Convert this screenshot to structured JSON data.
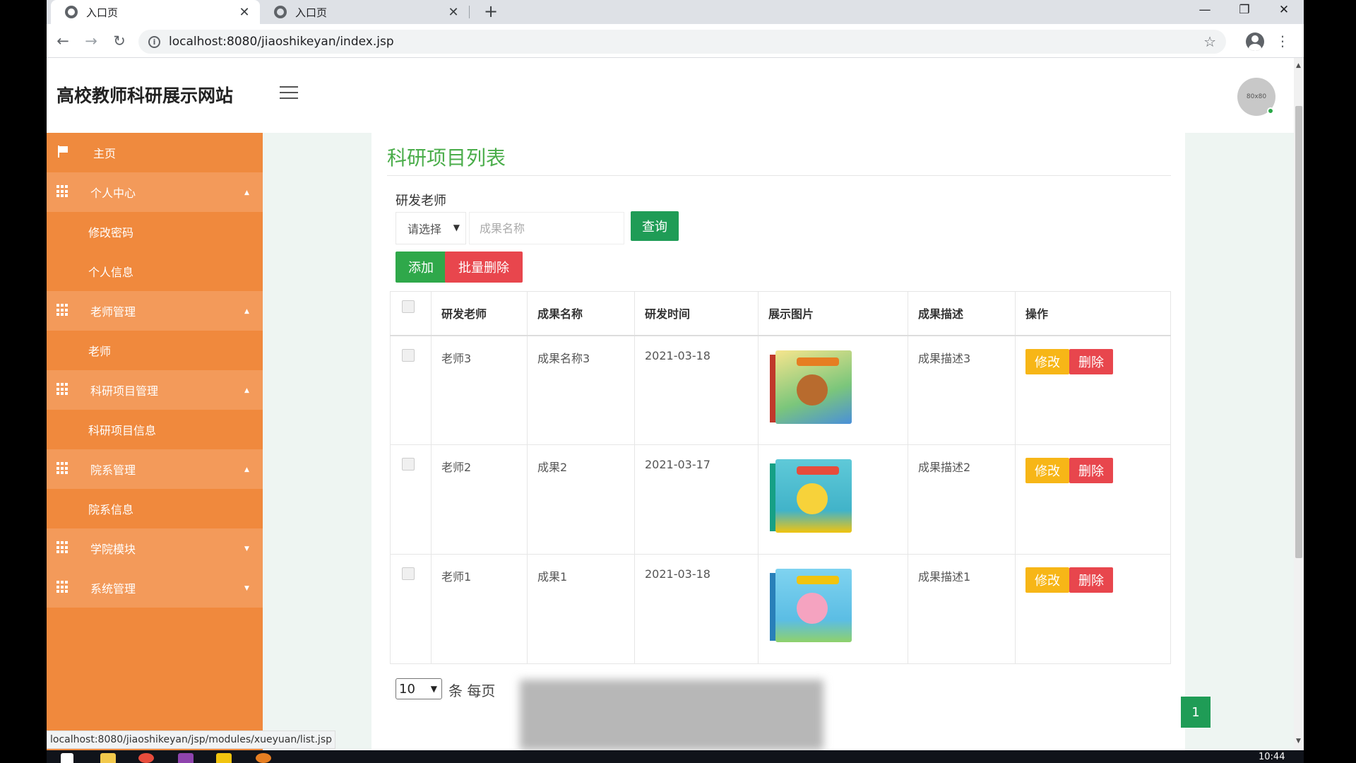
{
  "browser": {
    "tabs": [
      {
        "title": "入口页",
        "active": true
      },
      {
        "title": "入口页",
        "active": false
      }
    ],
    "url": "localhost:8080/jiaoshikeyan/index.jsp",
    "status_url": "localhost:8080/jiaoshikeyan/jsp/modules/xueyuan/list.jsp",
    "new_tab_glyph": "+",
    "close_glyph": "✕"
  },
  "header": {
    "site_title": "高校教师科研展示网站",
    "avatar_text": "80x80"
  },
  "sidebar": {
    "home": "主页",
    "items": [
      {
        "label": "个人中心",
        "type": "parent"
      },
      {
        "label": "修改密码",
        "type": "child"
      },
      {
        "label": "个人信息",
        "type": "child"
      },
      {
        "label": "老师管理",
        "type": "parent"
      },
      {
        "label": "老师",
        "type": "child"
      },
      {
        "label": "科研项目管理",
        "type": "parent"
      },
      {
        "label": "科研项目信息",
        "type": "child"
      },
      {
        "label": "院系管理",
        "type": "parent"
      },
      {
        "label": "院系信息",
        "type": "child"
      },
      {
        "label": "学院模块",
        "type": "parent"
      },
      {
        "label": "系统管理",
        "type": "parent"
      }
    ]
  },
  "main": {
    "title": "科研项目列表",
    "filter_label": "研发老师",
    "select_value": "请选择",
    "search_placeholder": "成果名称",
    "search_btn": "查询",
    "add_btn": "添加",
    "batch_delete_btn": "批量删除",
    "columns": [
      "研发老师",
      "成果名称",
      "研发时间",
      "展示图片",
      "成果描述",
      "操作"
    ],
    "rows": [
      {
        "teacher": "老师3",
        "name": "成果名称3",
        "date": "2021-03-18",
        "desc": "成果描述3",
        "image": "book-cover-1"
      },
      {
        "teacher": "老师2",
        "name": "成果2",
        "date": "2021-03-17",
        "desc": "成果描述2",
        "image": "book-cover-2"
      },
      {
        "teacher": "老师1",
        "name": "成果1",
        "date": "2021-03-18",
        "desc": "成果描述1",
        "image": "book-cover-3"
      }
    ],
    "edit_label": "修改",
    "delete_label": "删除",
    "page_size": "10",
    "per_page_text": "条 每页",
    "current_page": "1"
  },
  "taskbar": {
    "clock": "10:44"
  },
  "colors": {
    "sidebar": "#f0893d",
    "accent_green": "#1f9c56",
    "danger": "#e8464d",
    "warning": "#f7b617",
    "title_green": "#4aad4a"
  }
}
